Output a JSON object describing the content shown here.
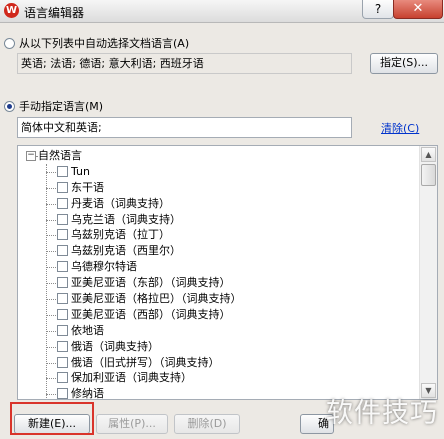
{
  "window": {
    "title": "语言编辑器",
    "help_glyph": "?",
    "close_glyph": "✕",
    "app_icon": "wps-logo-icon"
  },
  "auto_section": {
    "radio_label": "从以下列表中自动选择文档语言(A)",
    "selected": false,
    "languages_value": "英语; 法语; 德语; 意大利语; 西班牙语",
    "specify_button": "指定(S)..."
  },
  "manual_section": {
    "radio_label": "手动指定语言(M)",
    "selected": true,
    "languages_value": "简体中文和英语;",
    "clear_link": "清除(C)"
  },
  "tree": {
    "root_label": "自然语言",
    "root_expander": "−",
    "items": [
      {
        "label": "Tun",
        "checked": false
      },
      {
        "label": "东干语",
        "checked": false
      },
      {
        "label": "丹麦语（词典支持）",
        "checked": false
      },
      {
        "label": "乌克兰语（词典支持）",
        "checked": false
      },
      {
        "label": "乌兹别克语（拉丁）",
        "checked": false
      },
      {
        "label": "乌兹别克语（西里尔）",
        "checked": false
      },
      {
        "label": "乌德穆尔特语",
        "checked": false
      },
      {
        "label": "亚美尼亚语（东部）（词典支持）",
        "checked": false
      },
      {
        "label": "亚美尼亚语（格拉巴）（词典支持）",
        "checked": false
      },
      {
        "label": "亚美尼亚语（西部）（词典支持）",
        "checked": false
      },
      {
        "label": "依地语",
        "checked": false
      },
      {
        "label": "俄语（词典支持）",
        "checked": false
      },
      {
        "label": "俄语（旧式拼写）（词典支持）",
        "checked": false
      },
      {
        "label": "保加利亚语（词典支持）",
        "checked": false
      },
      {
        "label": "修纳语",
        "checked": false
      }
    ]
  },
  "footer": {
    "new_button": "新建(E)...",
    "properties_button": "属性(P)...",
    "delete_button": "删除(D)",
    "ok_button_partial": "确"
  },
  "watermark": "软件技巧",
  "colors": {
    "highlight_box": "#d9342b",
    "link": "#0033cc"
  }
}
